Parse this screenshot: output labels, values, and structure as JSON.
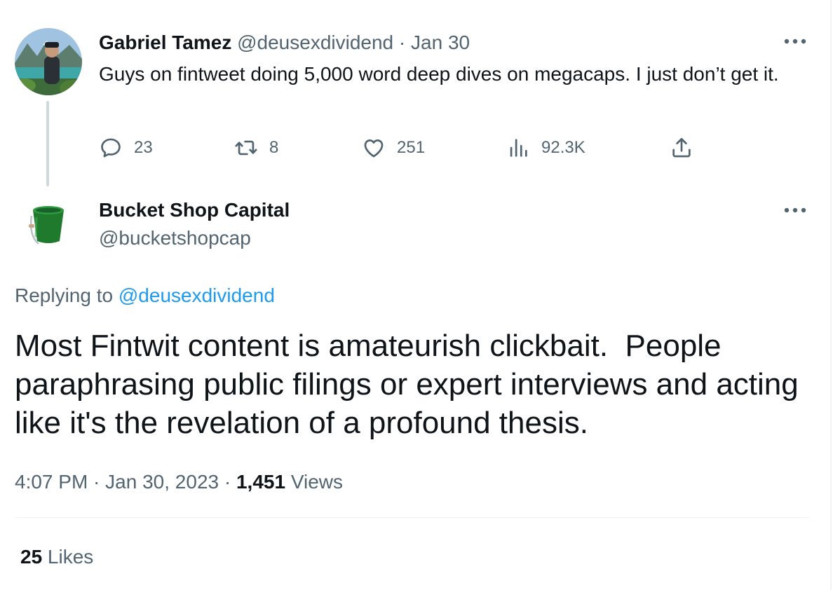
{
  "parent_tweet": {
    "name": "Gabriel Tamez",
    "handle": "@deusexdividend",
    "separator": " · ",
    "date": "Jan 30",
    "text": "Guys on fintweet doing 5,000 word deep dives on megacaps. I just don’t get it.",
    "stats": {
      "replies": "23",
      "retweets": "8",
      "likes": "251",
      "views": "92.3K"
    }
  },
  "reply_tweet": {
    "name": "Bucket Shop Capital",
    "handle": "@bucketshopcap",
    "replying_prefix": "Replying to ",
    "replying_to": "@deusexdividend",
    "text": "Most Fintwit content is amateurish clickbait.  People paraphrasing public filings or expert interviews and acting like it's the revelation of a profound thesis.",
    "time": "4:07 PM",
    "meta_sep1": " · ",
    "date": "Jan 30, 2023",
    "meta_sep2": " · ",
    "views_count": "1,451",
    "views_label": " Views",
    "likes_count": "25",
    "likes_label": " Likes"
  },
  "icons": {
    "more": "more-horizontal-icon",
    "reply": "speech-bubble-icon",
    "retweet": "retweet-arrows-icon",
    "like": "heart-icon",
    "views": "bar-chart-icon",
    "share": "share-upload-icon"
  },
  "colors": {
    "text_primary": "#0f1419",
    "text_secondary": "#536471",
    "link": "#1d9bf0",
    "thread_line": "#cfd9de",
    "bucket_green": "#1f7a2e"
  }
}
